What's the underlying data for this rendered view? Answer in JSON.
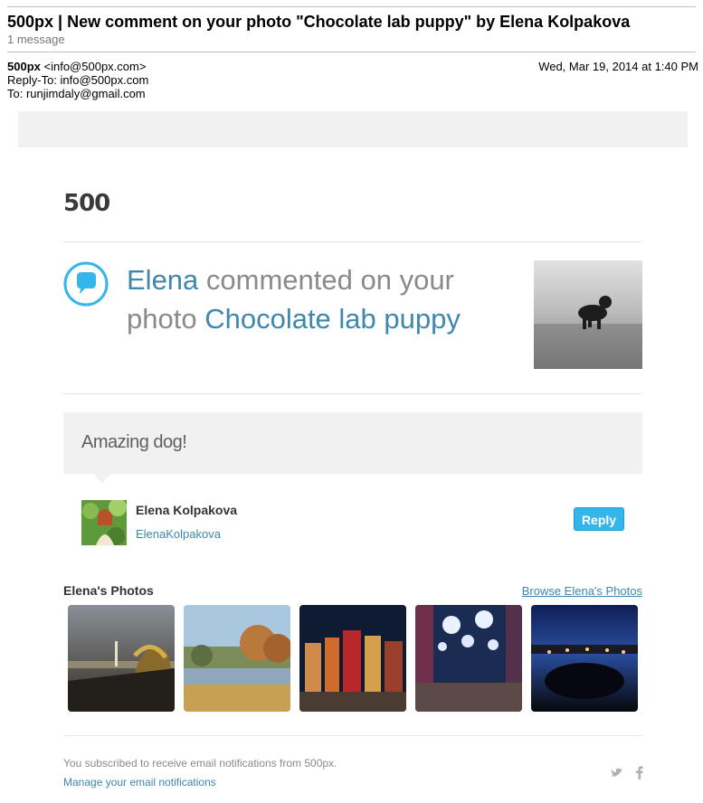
{
  "email": {
    "subject": "500px | New comment on your photo \"Chocolate lab puppy\" by Elena Kolpakova",
    "message_count": "1 message",
    "from_name": "500px",
    "from_email": "<info@500px.com>",
    "reply_to": "Reply-To: info@500px.com",
    "to": "To: runjimdaly@gmail.com",
    "date": "Wed, Mar 19, 2014 at 1:40 PM"
  },
  "brand": {
    "logo": "500",
    "accent": "#3f87ad",
    "button_color": "#35b6ea"
  },
  "notification": {
    "icon": "speech-bubble-icon",
    "user": "Elena",
    "text1": " commented on your",
    "text2": "photo ",
    "photo_title": "Chocolate lab puppy"
  },
  "comment": {
    "text": "Amazing dog!",
    "author_name": "Elena Kolpakova",
    "author_handle": "ElenaKolpakova",
    "reply_label": "Reply"
  },
  "photos": {
    "title": "Elena's Photos",
    "browse_label": "Browse Elena's Photos"
  },
  "footer": {
    "subscription_text": "You subscribed to receive email notifications from 500px.",
    "manage_link": "Manage your email notifications",
    "social_icons": [
      "twitter-icon",
      "facebook-icon"
    ]
  }
}
